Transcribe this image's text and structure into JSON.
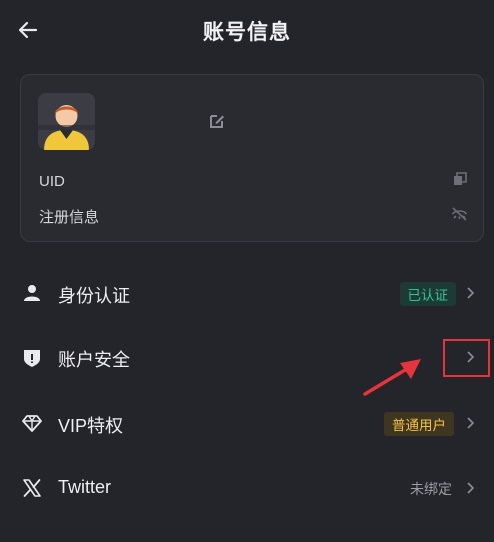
{
  "header": {
    "title": "账号信息"
  },
  "profile": {
    "uid_label": "UID",
    "register_label": "注册信息"
  },
  "menu": {
    "identity": {
      "label": "身份认证",
      "badge": "已认证"
    },
    "security": {
      "label": "账户安全"
    },
    "vip": {
      "label": "VIP特权",
      "badge": "普通用户"
    },
    "twitter": {
      "label": "Twitter",
      "value": "未绑定"
    }
  },
  "colors": {
    "background": "#24252b",
    "card": "#2a2b31",
    "verified_green": "#2fc592",
    "vip_yellow": "#f3c23d",
    "annotation_red": "#e5343b"
  },
  "icons": [
    "back-arrow-icon",
    "edit-icon",
    "copy-icon",
    "eye-hidden-icon",
    "person-icon",
    "shield-icon",
    "diamond-icon",
    "x-logo-icon",
    "chevron-right-icon"
  ]
}
